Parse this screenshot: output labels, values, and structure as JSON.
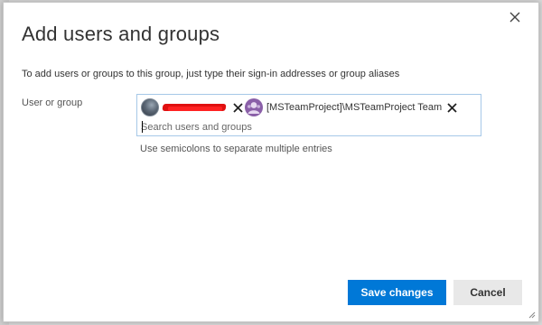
{
  "dialog": {
    "title": "Add users and groups",
    "description": "To add users or groups to this group, just type their sign-in addresses or group aliases",
    "close_icon": "close-icon"
  },
  "field": {
    "label": "User or group",
    "chips": [
      {
        "kind": "user",
        "name": "",
        "avatar": "user-avatar-icon",
        "remove_icon": "remove-icon"
      },
      {
        "kind": "group",
        "name": "[MSTeamProject]\\MSTeamProject Team",
        "avatar": "group-avatar-icon",
        "remove_icon": "remove-icon"
      }
    ],
    "search_placeholder": "Search users and groups",
    "hint": "Use semicolons to separate multiple entries"
  },
  "actions": {
    "save_label": "Save changes",
    "cancel_label": "Cancel"
  },
  "colors": {
    "primary": "#0078d7",
    "secondary_bg": "#e8e8e8",
    "input_border": "#a6c8e8",
    "group_avatar": "#8a5fa8",
    "redaction": "#e01010"
  }
}
